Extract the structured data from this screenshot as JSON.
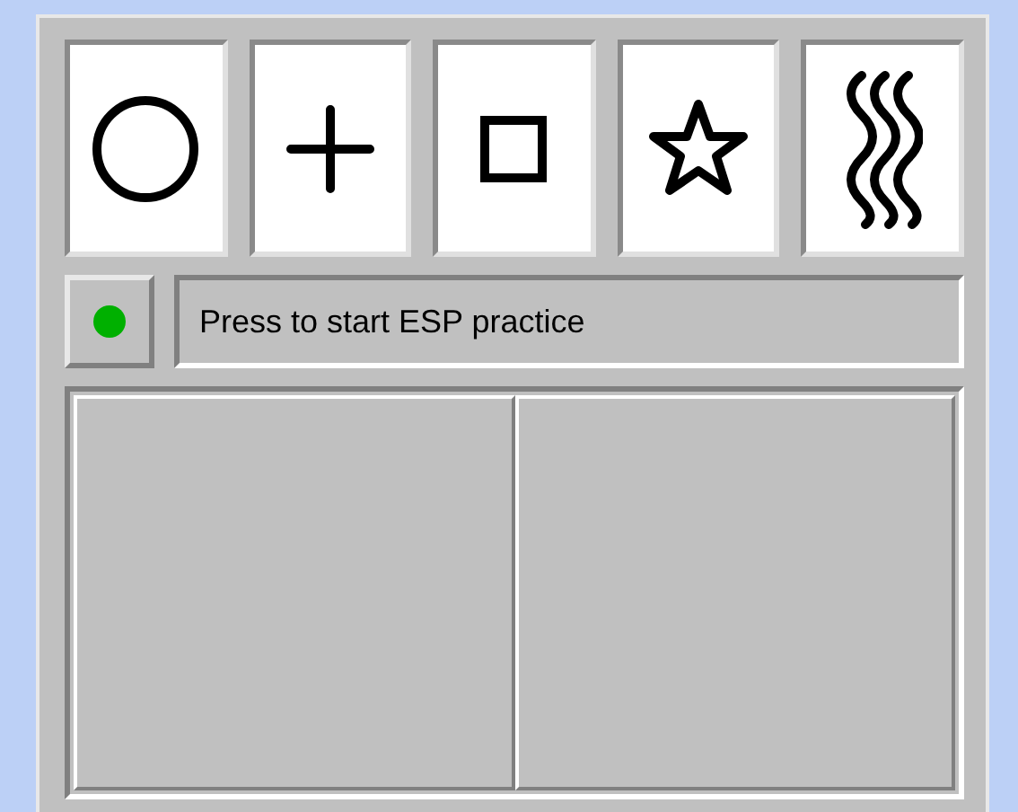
{
  "cards": [
    {
      "kind": "circle"
    },
    {
      "kind": "plus"
    },
    {
      "kind": "square"
    },
    {
      "kind": "star"
    },
    {
      "kind": "waves"
    }
  ],
  "start_button": {
    "color": "#00b000"
  },
  "message": "Press to start ESP practice"
}
